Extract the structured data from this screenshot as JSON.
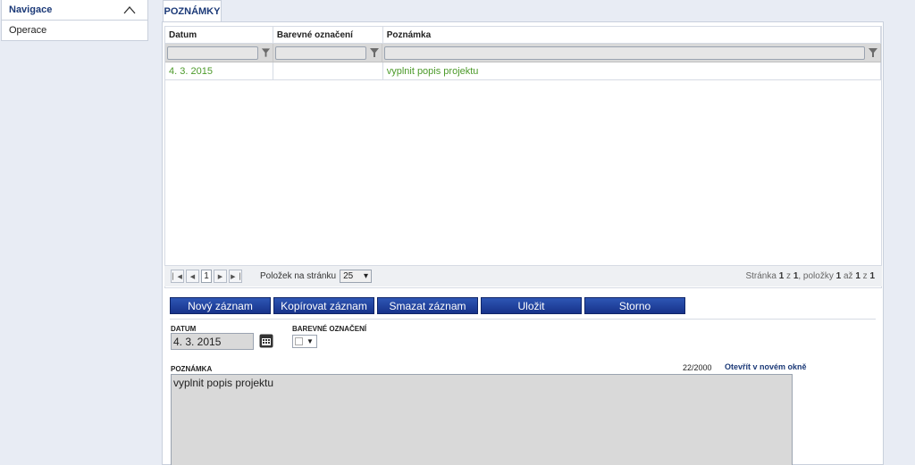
{
  "sidebar": {
    "title": "Navigace",
    "items": [
      {
        "label": "Operace"
      }
    ]
  },
  "tabs": [
    {
      "label": "POZNÁMKY"
    }
  ],
  "grid": {
    "columns": [
      "Datum",
      "Barevné označení",
      "Poznámka"
    ],
    "rows": [
      {
        "datum": "4. 3. 2015",
        "barva": "",
        "poznamka": "vyplnit popis projektu"
      }
    ]
  },
  "pager": {
    "current_page": "1",
    "per_page_label": "Položek na stránku",
    "per_page_value": "25",
    "info_prefix": "Stránka",
    "page": "1",
    "of": "z",
    "total_pages": "1",
    "items_label": ", položky",
    "from": "1",
    "to_label": "až",
    "to": "1",
    "of2": "z",
    "total": "1"
  },
  "toolbar": {
    "new": "Nový záznam",
    "copy": "Kopírovat záznam",
    "delete": "Smazat záznam",
    "save": "Uložit",
    "cancel": "Storno"
  },
  "form": {
    "datum_label": "DATUM",
    "datum_value": "4. 3. 2015",
    "color_label": "BAREVNÉ OZNAČENÍ",
    "note_label": "POZNÁMKA",
    "note_counter": "22/2000",
    "open_link": "Otevřít v novém okně",
    "note_value": "vyplnit popis projektu"
  },
  "colors": {
    "accent": "#1c3a78",
    "button": "#1f3f9a",
    "green_text": "#4c9a2a"
  }
}
